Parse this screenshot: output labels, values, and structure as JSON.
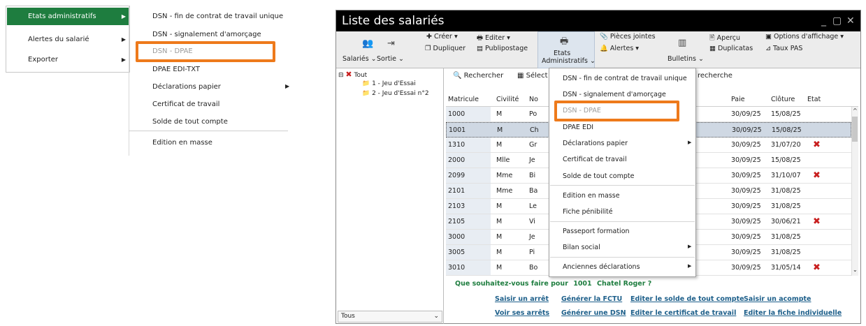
{
  "left_menu": {
    "items": [
      {
        "label": "Etats administratifs",
        "active": true
      },
      {
        "label": "Alertes du salarié",
        "active": false
      },
      {
        "label": "Exporter",
        "active": false
      }
    ]
  },
  "submenu": {
    "items": [
      "DSN - fin de contrat de travail unique",
      "DSN - signalement d'amorçage",
      "DSN - DPAE",
      "DPAE EDI-TXT",
      "Déclarations papier",
      "Certificat de travail",
      "Solde de tout compte",
      "Edition en masse"
    ]
  },
  "window": {
    "title": "Liste des salariés",
    "controls": {
      "minimize": "_",
      "restore": "▢",
      "close": "✕"
    }
  },
  "ribbon": {
    "salaries": "Salariés",
    "sortie": "Sortie",
    "creer": "Créer",
    "editer": "Editer",
    "dupliquer": "Dupliquer",
    "publipostage": "Publipostage",
    "etats_line1": "Etats",
    "etats_line2": "Administratifs",
    "pieces": "Pièces jointes",
    "alertes": "Alertes",
    "bulletins": "Bulletins",
    "apercu": "Aperçu",
    "duplicatas": "Duplicatas",
    "options": "Options d'affichage",
    "taux": "Taux PAS"
  },
  "tree": {
    "root": "Tout",
    "children": [
      "1 - Jeu d'Essai",
      "2 - Jeu d'Essai n°2"
    ],
    "filter": "Tous"
  },
  "toolbar": {
    "rechercher": "Rechercher",
    "select": "Sélect",
    "recherche": "recherche"
  },
  "table": {
    "headers": {
      "matricule": "Matricule",
      "civilite": "Civilité",
      "nom": "No",
      "paie": "Paie",
      "cloture": "Clôture",
      "etat": "Etat"
    },
    "rows": [
      {
        "matricule": "1000",
        "civilite": "M",
        "nom": "Po",
        "paie": "30/09/25",
        "cloture": "15/08/25",
        "x": false
      },
      {
        "matricule": "1001",
        "civilite": "M",
        "nom": "Ch",
        "paie": "30/09/25",
        "cloture": "15/08/25",
        "x": false
      },
      {
        "matricule": "1310",
        "civilite": "M",
        "nom": "Gr",
        "paie": "30/09/25",
        "cloture": "31/07/20",
        "x": true
      },
      {
        "matricule": "2000",
        "civilite": "Mlle",
        "nom": "Je",
        "paie": "30/09/25",
        "cloture": "15/08/25",
        "x": false
      },
      {
        "matricule": "2099",
        "civilite": "Mme",
        "nom": "Bi",
        "paie": "30/09/25",
        "cloture": "31/10/07",
        "x": true
      },
      {
        "matricule": "2101",
        "civilite": "Mme",
        "nom": "Ba",
        "paie": "30/09/25",
        "cloture": "31/08/25",
        "x": false
      },
      {
        "matricule": "2103",
        "civilite": "M",
        "nom": "Le",
        "paie": "30/09/25",
        "cloture": "31/08/25",
        "x": false
      },
      {
        "matricule": "2105",
        "civilite": "M",
        "nom": "Vi",
        "paie": "30/09/25",
        "cloture": "30/06/21",
        "x": true
      },
      {
        "matricule": "3000",
        "civilite": "M",
        "nom": "Je",
        "paie": "30/09/25",
        "cloture": "31/08/25",
        "x": false
      },
      {
        "matricule": "3005",
        "civilite": "M",
        "nom": "Pi",
        "paie": "30/09/25",
        "cloture": "31/08/25",
        "x": false
      },
      {
        "matricule": "3010",
        "civilite": "M",
        "nom": "Bo",
        "paie": "30/09/25",
        "cloture": "31/05/14",
        "x": true
      }
    ]
  },
  "dropdown": {
    "items": [
      "DSN - fin de contrat de travail unique",
      "DSN - signalement d'amorçage",
      "DSN - DPAE",
      "DPAE EDI",
      "Déclarations papier",
      "Certificat de travail",
      "Solde de tout compte",
      "Edition en masse",
      "Fiche pénibilité",
      "Passeport formation",
      "Bilan social",
      "Anciennes déclarations"
    ]
  },
  "bottom": {
    "question": "Que souhaitez-vous faire pour",
    "matricule": "1001",
    "name": "Chatel Roger ?",
    "links": [
      "Saisir un arrêt",
      "Générer la FCTU",
      "Editer le solde de tout compte",
      "Saisir un acompte",
      "Voir ses arrêts",
      "Générer une DSN",
      "Editer le certificat de travail",
      "Editer la fiche individuelle"
    ]
  },
  "colors": {
    "accent_green": "#1e7d3f",
    "highlight_orange": "#ee7a1b",
    "error_red": "#c81e1e",
    "link_blue": "#1d5f8a"
  }
}
